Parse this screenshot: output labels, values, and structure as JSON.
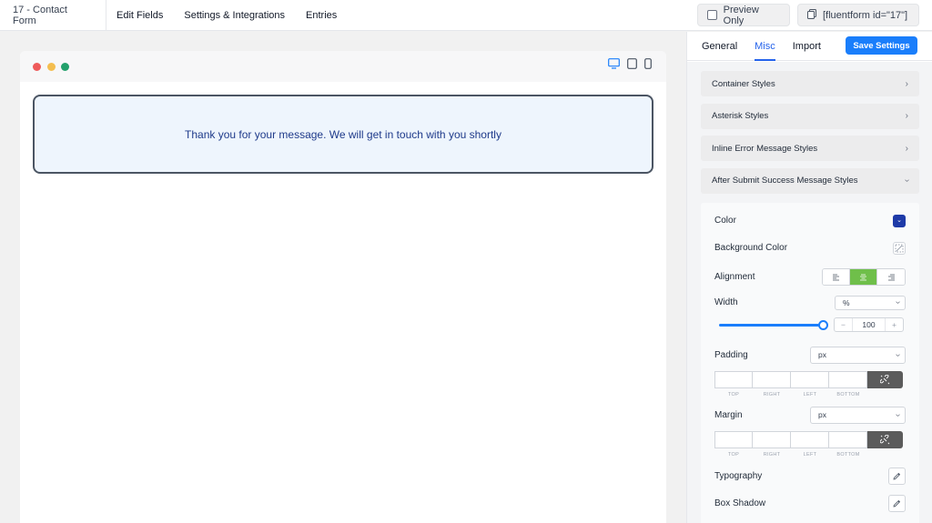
{
  "topbar": {
    "form_title": "17 - Contact Form",
    "nav": [
      "Edit Fields",
      "Settings & Integrations",
      "Entries"
    ],
    "preview_label": "Preview Only",
    "shortcode": "[fluentform id=\"17\"]"
  },
  "canvas": {
    "success_message": "Thank you for your message. We will get in touch with you shortly",
    "message_color": "#1e3a8a",
    "message_background": "#eef5fd"
  },
  "panel": {
    "tabs": [
      "General",
      "Misc",
      "Import"
    ],
    "active_tab": "Misc",
    "save_label": "Save Settings",
    "accordions": [
      "Container Styles",
      "Asterisk Styles",
      "Inline Error Message Styles",
      "After Submit Success Message Styles"
    ],
    "expanded_accordion": "After Submit Success Message Styles",
    "fields": {
      "color_label": "Color",
      "color_value": "#1e3aa8",
      "bg_color_label": "Background Color",
      "alignment_label": "Alignment",
      "alignment_value": "center",
      "width_label": "Width",
      "width_unit": "%",
      "width_value": "100",
      "width_fraction": 1.0,
      "padding_label": "Padding",
      "padding_unit": "px",
      "margin_label": "Margin",
      "margin_unit": "px",
      "box_labels": [
        "TOP",
        "RIGHT",
        "LEFT",
        "BOTTOM"
      ],
      "typography_label": "Typography",
      "box_shadow_label": "Box Shadow"
    }
  },
  "colors": {
    "accent": "#1a7efb",
    "align_active": "#6fbf4a"
  }
}
